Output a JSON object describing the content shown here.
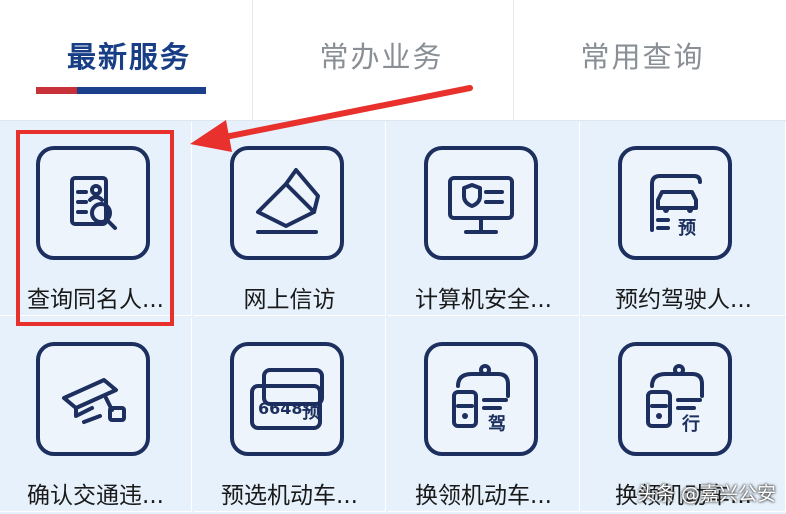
{
  "tabs": [
    {
      "label": "最新服务",
      "active": true
    },
    {
      "label": "常办业务",
      "active": false
    },
    {
      "label": "常用查询",
      "active": false
    }
  ],
  "services": [
    {
      "label": "查询同名人...",
      "icon": "person-search-icon"
    },
    {
      "label": "网上信访",
      "icon": "envelope-icon"
    },
    {
      "label": "计算机安全...",
      "icon": "computer-shield-icon"
    },
    {
      "label": "预约驾驶人...",
      "icon": "car-document-icon"
    },
    {
      "label": "确认交通违...",
      "icon": "surveillance-camera-icon"
    },
    {
      "label": "预选机动车...",
      "icon": "license-plate-icon"
    },
    {
      "label": "换领机动车...",
      "icon": "vehicle-driving-icon"
    },
    {
      "label": "换领机动车...",
      "icon": "vehicle-travel-icon"
    }
  ],
  "icon_text": {
    "plate_number": "6648",
    "yu": "预",
    "jia": "驾",
    "xing": "行"
  },
  "watermark": "头条 @嘉兴公安",
  "colors": {
    "accent": "#183f85",
    "highlight": "#e8302c",
    "tile_bg": "#e6f1fb"
  }
}
